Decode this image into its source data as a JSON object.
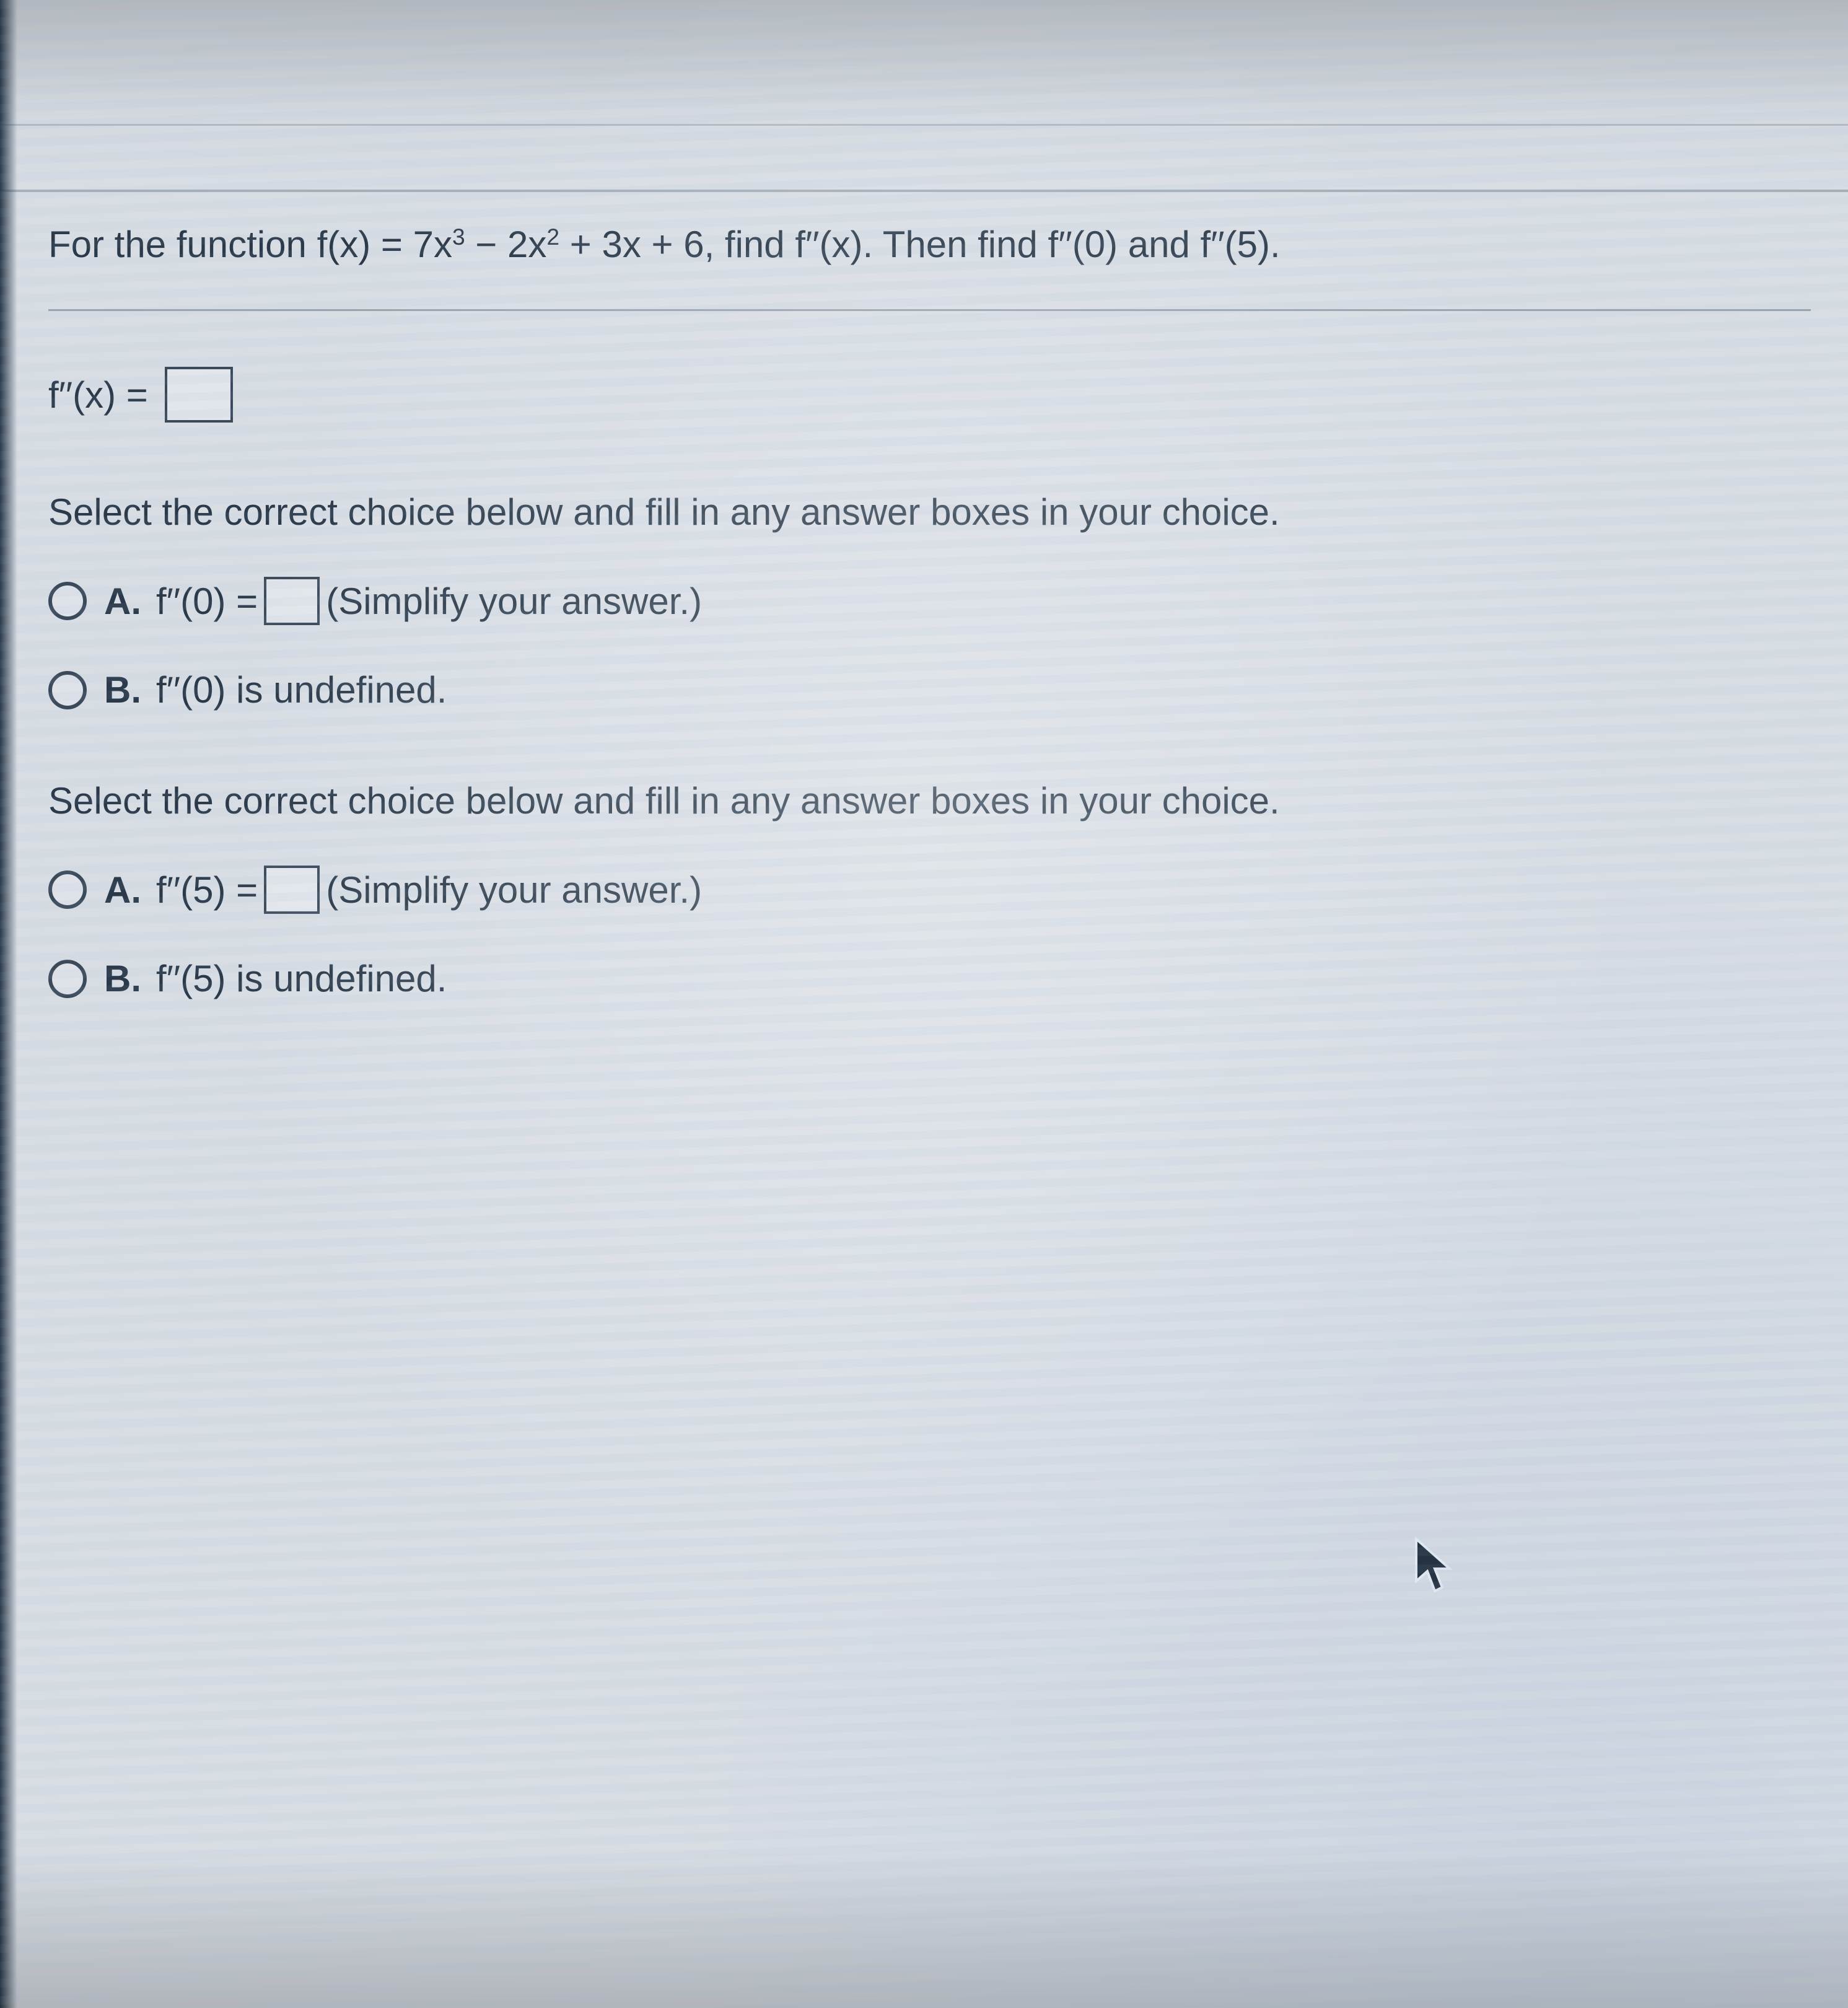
{
  "chart_data": null,
  "question": {
    "pre": "For the function f(x) = 7x",
    "exp1": "3",
    "mid1": " − 2x",
    "exp2": "2",
    "mid2": " + 3x + 6, find f′′(x). Then find f′′(0) and f′′(5)."
  },
  "fpp_line": {
    "lhs": "f′′(x) = "
  },
  "instruction": "Select the correct choice below and fill in any answer boxes in your choice.",
  "group1": {
    "A": {
      "label": "A.",
      "pre": "f′′(0) = ",
      "post": " (Simplify your answer.)"
    },
    "B": {
      "label": "B.",
      "text": "f′′(0) is undefined."
    }
  },
  "group2": {
    "A": {
      "label": "A.",
      "pre": "f′′(5) = ",
      "post": " (Simplify your answer.)"
    },
    "B": {
      "label": "B.",
      "text": "f′′(5) is undefined."
    }
  }
}
